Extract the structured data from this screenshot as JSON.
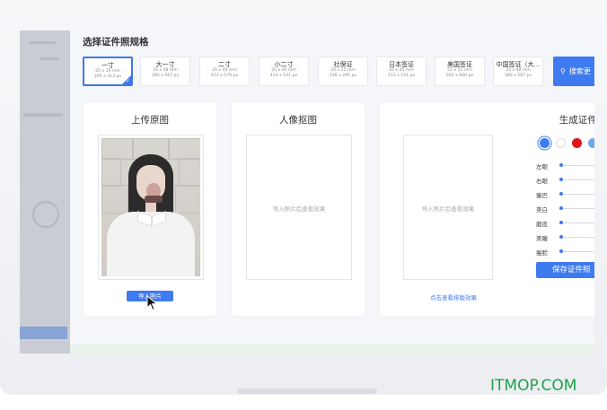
{
  "page_title": "选择证件照规格",
  "specs": [
    {
      "name": "一寸",
      "dim1": "25 x 35 mm",
      "dim2": "295 x 413 px",
      "selected": true
    },
    {
      "name": "大一寸",
      "dim1": "33 x 48 mm",
      "dim2": "390 x 567 px"
    },
    {
      "name": "二寸",
      "dim1": "35 x 49 mm",
      "dim2": "413 x 579 px"
    },
    {
      "name": "小二寸",
      "dim1": "35 x 45 mm",
      "dim2": "413 x 531 px"
    },
    {
      "name": "社保证",
      "dim1": "20 x 25 mm",
      "dim2": "236 x 295 px"
    },
    {
      "name": "日本签证",
      "dim1": "45 x 45 mm",
      "dim2": "531 x 531 px"
    },
    {
      "name": "美国签证",
      "dim1": "51 x 51 mm",
      "dim2": "600 x 600 px"
    },
    {
      "name": "中国签证（大…",
      "dim1": "33 x 48 mm",
      "dim2": "390 x 567 px"
    }
  ],
  "search_button": "搜索更",
  "panels": {
    "upload": {
      "title": "上传原图",
      "button": "导入照片"
    },
    "cutout": {
      "title": "人像抠图",
      "placeholder": "导入照片后查看效果"
    },
    "generate": {
      "title": "生成证件照",
      "placeholder": "导入照片后查看效果",
      "link": "点击查看排版效果",
      "save_button": "保存证件照",
      "colors": [
        "#3e7bf0",
        "#ffffff",
        "#e01515",
        "#6fa8e8"
      ],
      "sliders": [
        "左眼",
        "右眼",
        "瘦巴",
        "美白",
        "磨皮",
        "美瞳",
        "瘦脸"
      ]
    }
  },
  "watermark": "ITMOP.COM"
}
